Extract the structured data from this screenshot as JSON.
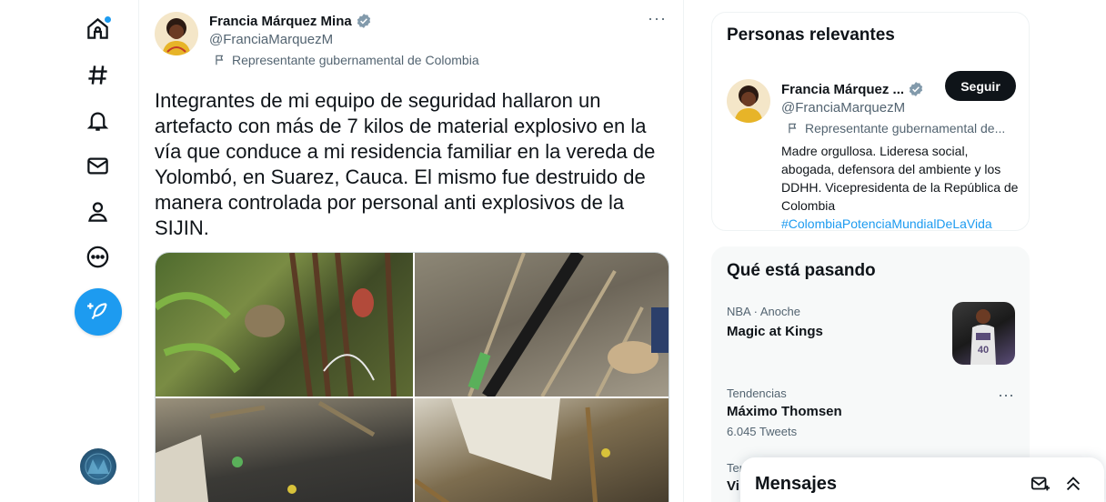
{
  "nav": {
    "items": [
      {
        "name": "home",
        "icon": "home-icon"
      },
      {
        "name": "explore",
        "icon": "hashtag-icon"
      },
      {
        "name": "notifications",
        "icon": "bell-icon"
      },
      {
        "name": "messages",
        "icon": "mail-icon"
      },
      {
        "name": "profile",
        "icon": "person-icon"
      },
      {
        "name": "more",
        "icon": "more-circle-icon"
      }
    ],
    "compose_icon": "feather-plus-icon",
    "accent": "#1d9bf0"
  },
  "tweet": {
    "author_name": "Francia Márquez Mina",
    "handle": "@FranciaMarquezM",
    "label": "Representante gubernamental de Colombia",
    "more": "···",
    "text": "Integrantes de mi equipo de seguridad hallaron un artefacto con más de 7 kilos de material explosivo en la vía que conduce a mi residencia familiar en la vereda de Yolombó, en Suarez, Cauca. El mismo fue destruido de manera controlada por personal anti explosivos de la SIJIN."
  },
  "relevant": {
    "title": "Personas relevantes",
    "name": "Francia Márquez ...",
    "handle": "@FranciaMarquezM",
    "label": "Representante gubernamental de...",
    "bio": "Madre orgullosa. Lideresa social, abogada, defensora del ambiente y los DDHH. Vicepresidenta de la República de Colombia",
    "hashtag": "#ColombiaPotenciaMundialDeLaVida",
    "follow_label": "Seguir"
  },
  "trends": {
    "title": "Qué está pasando",
    "items": [
      {
        "meta": "NBA · Anoche",
        "title": "Magic at Kings"
      },
      {
        "meta": "Tendencias",
        "title": "Máximo Thomsen",
        "count": "6.045 Tweets",
        "more": "···"
      },
      {
        "meta": "Ten",
        "title": "Vi"
      }
    ]
  },
  "messages": {
    "title": "Mensajes"
  }
}
